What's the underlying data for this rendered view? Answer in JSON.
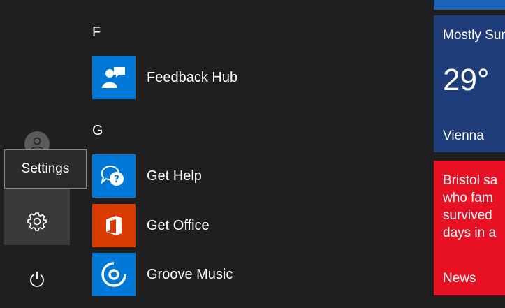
{
  "rail": {
    "tooltip": "Settings",
    "colors": {
      "rail_bg": "#1f1f1f",
      "hover_bg": "#3a3a3a"
    }
  },
  "apps": {
    "groups": [
      {
        "letter": "F",
        "items": [
          {
            "label": "Feedback Hub",
            "icon": "feedback-hub-icon",
            "color": "#0078d7"
          }
        ]
      },
      {
        "letter": "G",
        "items": [
          {
            "label": "Get Help",
            "icon": "get-help-icon",
            "color": "#0078d7"
          },
          {
            "label": "Get Office",
            "icon": "office-icon",
            "color": "#d83b01"
          },
          {
            "label": "Groove Music",
            "icon": "groove-music-icon",
            "color": "#0078d7"
          }
        ]
      }
    ]
  },
  "tiles": {
    "weather": {
      "title": "Mostly Sunny",
      "temp": "29°",
      "city": "Vienna",
      "color": "#1e3d7a"
    },
    "news": {
      "headline": "Bristol says family who famously survived days in a",
      "lines": [
        "Bristol sa",
        "who fam",
        "survived",
        "days in a"
      ],
      "label": "News",
      "color": "#e81123"
    }
  }
}
